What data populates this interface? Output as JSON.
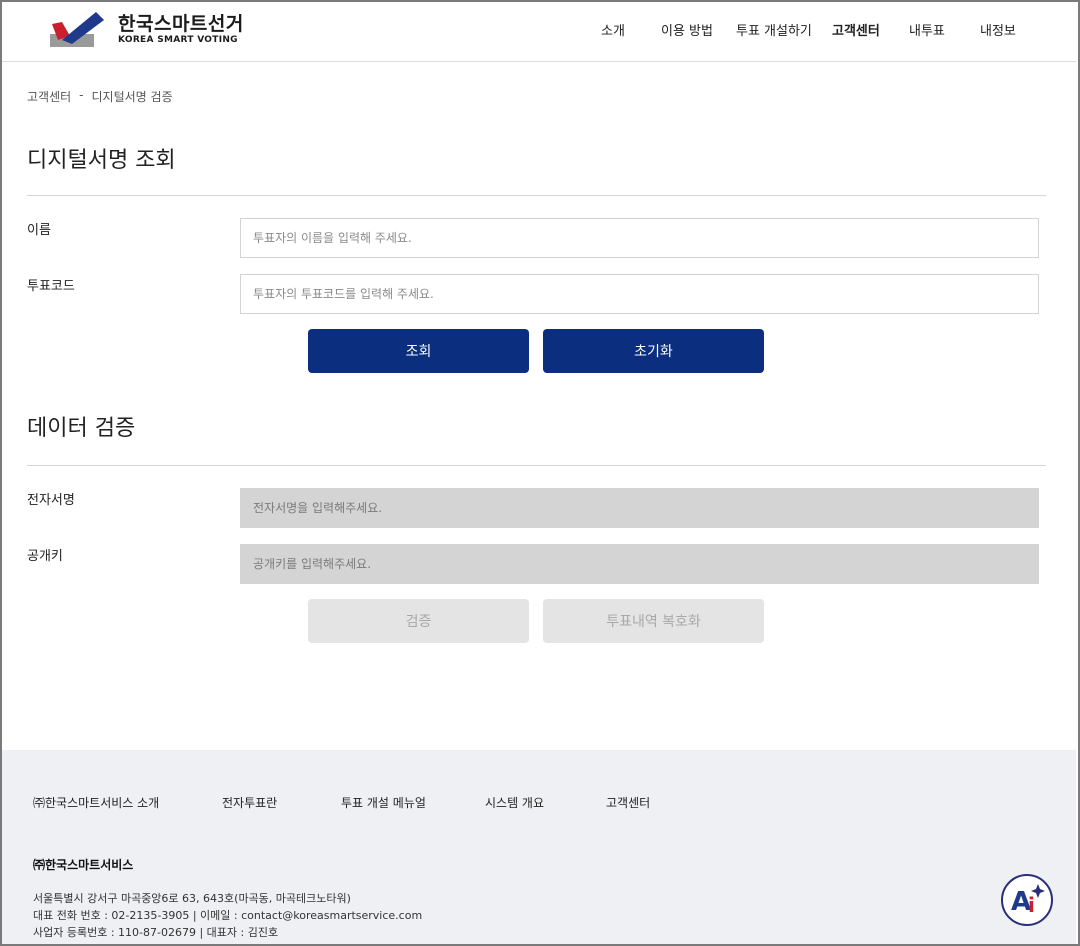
{
  "header": {
    "logo_title": "한국스마트선거",
    "logo_subtitle": "KOREA SMART VOTING",
    "nav": [
      {
        "label": "소개"
      },
      {
        "label": "이용 방법"
      },
      {
        "label": "투표 개설하기"
      },
      {
        "label": "고객센터",
        "active": true
      },
      {
        "label": "내투표"
      },
      {
        "label": "내정보"
      }
    ]
  },
  "breadcrumb": {
    "first": "고객센터",
    "separator": "-",
    "current": "디지털서명 검증"
  },
  "signature_lookup": {
    "title": "디지털서명 조회",
    "name_label": "이름",
    "name_placeholder": "투표자의 이름을 입력해 주세요.",
    "code_label": "투표코드",
    "code_placeholder": "투표자의 투표코드를 입력해 주세요.",
    "search_button": "조회",
    "reset_button": "초기화"
  },
  "data_verification": {
    "title": "데이터 검증",
    "signature_label": "전자서명",
    "signature_placeholder": "전자서명을 입력해주세요.",
    "public_key_label": "공개키",
    "public_key_placeholder": "공개키를 입력해주세요.",
    "verify_button": "검증",
    "decrypt_button": "투표내역 복호화"
  },
  "footer": {
    "links": [
      "㈜한국스마트서비스 소개",
      "전자투표란",
      "투표 개설 메뉴얼",
      "시스템 개요",
      "고객센터"
    ],
    "company": "㈜한국스마트서비스",
    "address": "서울특별시 강서구 마곡중앙6로 63, 643호(마곡동, 마곡테크노타워)",
    "contact": "대표 전화 번호 : 02-2135-3905 | 이메일 : contact@koreasmartservice.com",
    "business": "사업자 등록번호 : 110-87-02679 | 대표자 : 김진호"
  },
  "colors": {
    "primary": "#0b2e7e",
    "disabled_bg": "#e4e4e4",
    "footer_bg": "#eef0f4",
    "logo_red": "#c8202f",
    "logo_blue": "#1f3a8a"
  },
  "icons": {
    "logo": "ballot-check-logo",
    "badge": "ai-assistant-icon"
  }
}
